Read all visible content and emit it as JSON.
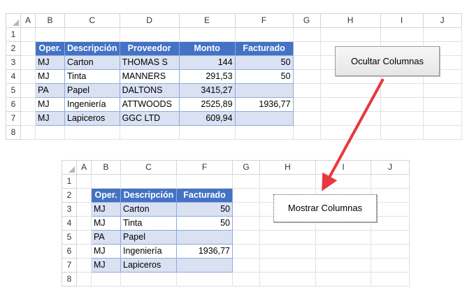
{
  "top_sheet": {
    "col_headers": [
      "A",
      "B",
      "C",
      "D",
      "E",
      "F",
      "G",
      "H",
      "I",
      "J"
    ],
    "row_headers": [
      "1",
      "2",
      "3",
      "4",
      "5",
      "6",
      "7",
      "8"
    ],
    "table_headers": [
      "Oper.",
      "Descripción",
      "Proveedor",
      "Monto",
      "Facturado"
    ],
    "rows": [
      [
        "MJ",
        "Carton",
        "THOMAS S",
        "144",
        "50"
      ],
      [
        "MJ",
        "Tinta",
        "MANNERS",
        "291,53",
        "50"
      ],
      [
        "PA",
        "Papel",
        "DALTONS",
        "3415,27",
        ""
      ],
      [
        "MJ",
        "Ingeniería",
        "ATTWOODS",
        "2525,89",
        "1936,77"
      ],
      [
        "MJ",
        "Lapiceros",
        "GGC LTD",
        "609,94",
        ""
      ]
    ]
  },
  "bottom_sheet": {
    "col_headers": [
      "A",
      "B",
      "C",
      "F",
      "G",
      "H",
      "I",
      "J"
    ],
    "row_headers": [
      "1",
      "2",
      "3",
      "4",
      "5",
      "6",
      "7",
      "8"
    ],
    "table_headers": [
      "Oper.",
      "Descripción",
      "Facturado"
    ],
    "rows": [
      [
        "MJ",
        "Carton",
        "50"
      ],
      [
        "MJ",
        "Tinta",
        "50"
      ],
      [
        "PA",
        "Papel",
        ""
      ],
      [
        "MJ",
        "Ingeniería",
        "1936,77"
      ],
      [
        "MJ",
        "Lapiceros",
        ""
      ]
    ]
  },
  "buttons": {
    "hide_label": "Ocultar Columnas",
    "show_label": "Mostrar Columnas"
  },
  "colors": {
    "header_fill": "#4472c4",
    "band_fill": "#d9e1f2",
    "arrow": "#e8383d"
  }
}
